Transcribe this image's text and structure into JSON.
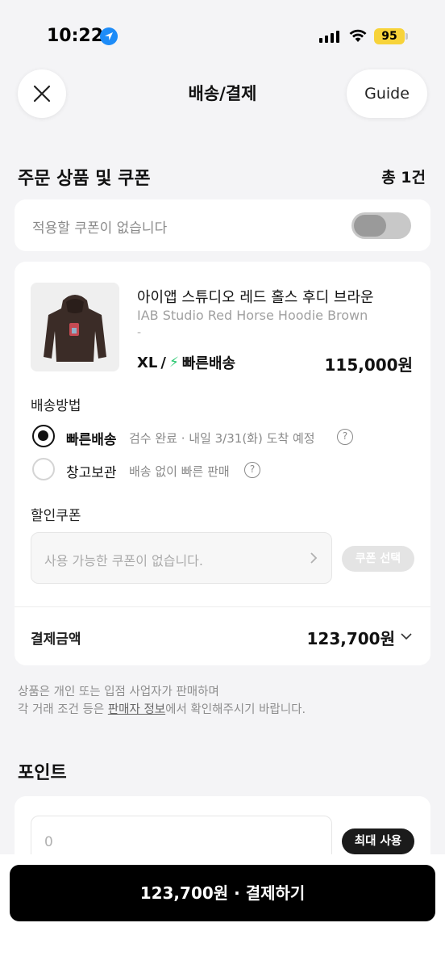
{
  "status_bar": {
    "time": "10:22",
    "battery": "95",
    "battery_color": "#f7d33a",
    "location_color": "#1d8cf8"
  },
  "header": {
    "title": "배송/결제",
    "guide_label": "Guide",
    "close_icon": "close-icon"
  },
  "order_section": {
    "title": "주문 상품 및 쿠폰",
    "count": "총 1건"
  },
  "coupon_toggle": {
    "label": "적용할 쿠폰이 없습니다",
    "enabled": false
  },
  "product": {
    "name_ko": "아이앱 스튜디오 레드 홀스 후디 브라운",
    "name_en": "IAB Studio Red Horse Hoodie Brown",
    "name_dash": "-",
    "size": "XL",
    "separator": "/",
    "shipping_badge": "빠른배송",
    "price": "115,000원",
    "accent_color": "#28c76f"
  },
  "shipping_method": {
    "title": "배송방법",
    "options": [
      {
        "name": "빠른배송",
        "desc": "검수 완료 · 내일 3/31(화) 도착 예정",
        "selected": true
      },
      {
        "name": "창고보관",
        "desc": "배송 없이 빠른 판매",
        "selected": false
      }
    ],
    "help_glyph": "?"
  },
  "discount_coupon": {
    "title": "할인쿠폰",
    "placeholder": "사용 가능한 쿠폰이 없습니다.",
    "select_label": "쿠폰 선택"
  },
  "payment": {
    "label": "결제금액",
    "amount": "123,700원"
  },
  "notice": {
    "line1": "상품은 개인 또는 입점 사업자가 판매하며",
    "line2_prefix": "각 거래 조건 등은 ",
    "line2_link": "판매자 정보",
    "line2_suffix": "에서 확인해주시기 바랍니다."
  },
  "points": {
    "title": "포인트",
    "placeholder": "0",
    "max_label": "최대 사용"
  },
  "cta": {
    "label": "123,700원 · 결제하기"
  }
}
